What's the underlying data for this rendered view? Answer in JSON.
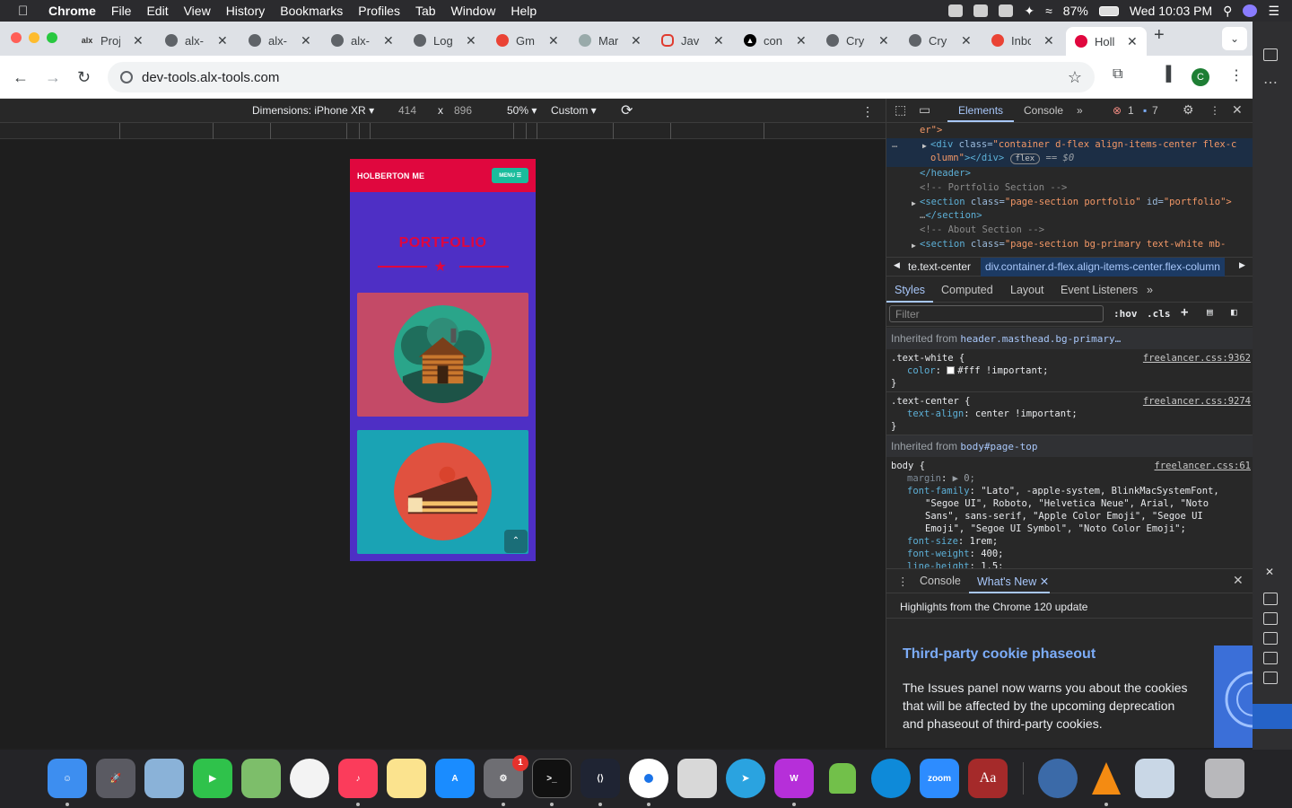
{
  "menubar": {
    "app": "Chrome",
    "items": [
      "File",
      "Edit",
      "View",
      "History",
      "Bookmarks",
      "Profiles",
      "Tab",
      "Window",
      "Help"
    ],
    "battery": "87%",
    "clock": "Wed 10:03 PM"
  },
  "tabs": [
    {
      "label": "Proj",
      "icon": "alx-icon"
    },
    {
      "label": "alx-",
      "icon": "github-icon"
    },
    {
      "label": "alx-",
      "icon": "github-icon"
    },
    {
      "label": "alx-",
      "icon": "github-icon"
    },
    {
      "label": "Log",
      "icon": "globe-icon"
    },
    {
      "label": "Gm",
      "icon": "gmail-icon"
    },
    {
      "label": "Mar",
      "icon": "globe-icon"
    },
    {
      "label": "Jav",
      "icon": "oracle-icon"
    },
    {
      "label": "con",
      "icon": "vercel-icon"
    },
    {
      "label": "Cry",
      "icon": "globe-icon"
    },
    {
      "label": "Cry",
      "icon": "globe-icon"
    },
    {
      "label": "Inbo",
      "icon": "gmail-icon"
    },
    {
      "label": "Holl",
      "icon": "holberton-icon",
      "active": true
    }
  ],
  "address": {
    "url": "dev-tools.alx-tools.com",
    "profile_initial": "C"
  },
  "device_toolbar": {
    "dimensions": "Dimensions: iPhone XR",
    "width": "414",
    "times": "x",
    "height": "896",
    "zoom": "50%",
    "throttle": "Custom"
  },
  "phone_page": {
    "brand": "HOLBERTON ME",
    "menu": "MENU",
    "section_title": "PORTFOLIO",
    "colors": {
      "nav": "#e0073e",
      "bg": "#4e2fc5",
      "card1": "#c44a67",
      "card2": "#1aa3b4"
    }
  },
  "devtools": {
    "tabs": [
      "Elements",
      "Console"
    ],
    "error_count": "1",
    "message_count": "7",
    "dom_lines": {
      "l0": "er\">",
      "l1_tag": "<div ",
      "l1_attr": "class=",
      "l1_val": "\"container d-flex align-items-center flex-c",
      "l2_val": "olumn\"",
      "l2_end": "></div>",
      "l2_flex": "flex",
      "l2_eq": "== $0",
      "l3": "</header>",
      "l4": "<!-- Portfolio Section -->",
      "l5_tag": "<section ",
      "l5_attr": "class=",
      "l5_val": "\"page-section portfolio\"",
      "l5_attr2": " id=",
      "l5_val2": "\"portfolio\">",
      "l6": "</section>",
      "l7": "<!-- About Section -->",
      "l8_tag": "<section ",
      "l8_attr": "class=",
      "l8_val": "\"page-section bg-primary text-white mb-"
    },
    "breadcrumbs": [
      "te.text-center",
      "div.container.d-flex.align-items-center.flex-column"
    ],
    "subtabs": [
      "Styles",
      "Computed",
      "Layout",
      "Event Listeners"
    ],
    "filter_placeholder": "Filter",
    "hov": ":hov",
    "cls": ".cls",
    "inherited1_label": "Inherited from",
    "inherited1_sel": "header.masthead.bg-primary…",
    "rule1": {
      "selector": ".text-white {",
      "source": "freelancer.css:9362",
      "prop": "color",
      "value": "#fff !important;"
    },
    "rule2": {
      "selector": ".text-center {",
      "source": "freelancer.css:9274",
      "prop": "text-align",
      "value": "center !important;"
    },
    "inherited2_label": "Inherited from",
    "inherited2_sel": "body#page-top",
    "rule3": {
      "selector": "body {",
      "source": "freelancer.css:61",
      "margin": "margin",
      "margin_val": "▶ 0;",
      "ff": "font-family",
      "ff_val1": "\"Lato\", -apple-system, BlinkMacSystemFont,",
      "ff_val2": "\"Segoe UI\", Roboto, \"Helvetica Neue\", Arial, \"Noto",
      "ff_val3": "Sans\", sans-serif, \"Apple Color Emoji\", \"Segoe UI",
      "ff_val4": "Emoji\", \"Segoe UI Symbol\", \"Noto Color Emoji\";",
      "fs": "font-size",
      "fs_val": "1rem;",
      "fw": "font-weight",
      "fw_val": "400;",
      "lh": "line-height",
      "lh_val": "1.5;"
    },
    "close_brace": "}",
    "drawer_tabs": [
      "Console",
      "What's New"
    ],
    "whatsnew_heading": "Highlights from the Chrome 120 update",
    "article_title": "Third-party cookie phaseout",
    "article_body": "The Issues panel now warns you about the cookies that will be affected by the upcoming deprecation and phaseout of third-party cookies."
  },
  "dock": {
    "zoom_label": "zoom",
    "dictionary_label": "Aa",
    "settings_badge": "1"
  }
}
